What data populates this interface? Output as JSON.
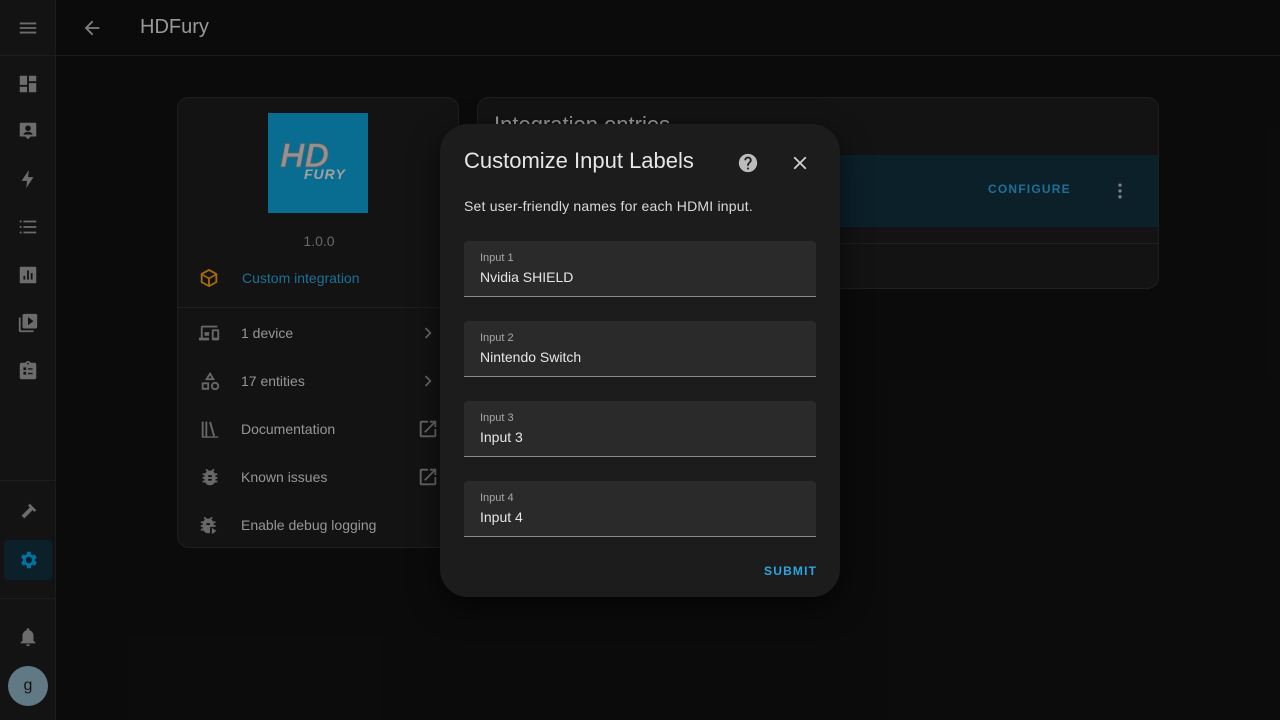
{
  "header": {
    "title": "HDFury"
  },
  "sidebar": {
    "items": [
      {
        "icon": "menu-icon"
      },
      {
        "icon": "dashboard-icon"
      },
      {
        "icon": "map-icon"
      },
      {
        "icon": "energy-icon"
      },
      {
        "icon": "logbook-icon"
      },
      {
        "icon": "history-icon"
      },
      {
        "icon": "media-icon"
      },
      {
        "icon": "todo-icon"
      },
      {
        "icon": "developer-tools-icon"
      },
      {
        "icon": "settings-icon",
        "active": true
      },
      {
        "icon": "notifications-icon"
      }
    ],
    "avatar_initial": "g"
  },
  "integration": {
    "logo_text": "HD FURY",
    "version": "1.0.0",
    "custom_label": "Custom integration",
    "rows": [
      {
        "label": "1 device",
        "icon": "devices-icon",
        "trail": "chevron-right-icon"
      },
      {
        "label": "17 entities",
        "icon": "shapes-icon",
        "trail": "chevron-right-icon"
      },
      {
        "label": "Documentation",
        "icon": "book-icon",
        "trail": "open-external-icon"
      },
      {
        "label": "Known issues",
        "icon": "bug-icon",
        "trail": "open-external-icon"
      },
      {
        "label": "Enable debug logging",
        "icon": "bug-play-icon",
        "trail": ""
      }
    ]
  },
  "entries": {
    "title": "Integration entries",
    "configure_label": "CONFIGURE"
  },
  "dialog": {
    "title": "Customize Input Labels",
    "description": "Set user-friendly names for each HDMI input.",
    "fields": [
      {
        "label": "Input 1",
        "value": "Nvidia SHIELD"
      },
      {
        "label": "Input 2",
        "value": "Nintendo Switch"
      },
      {
        "label": "Input 3",
        "value": "Input 3"
      },
      {
        "label": "Input 4",
        "value": "Input 4"
      }
    ],
    "submit_label": "SUBMIT"
  },
  "colors": {
    "accent": "#03a9f4",
    "logo_bg": "#0ea1d6",
    "custom_icon": "#f39c12"
  }
}
